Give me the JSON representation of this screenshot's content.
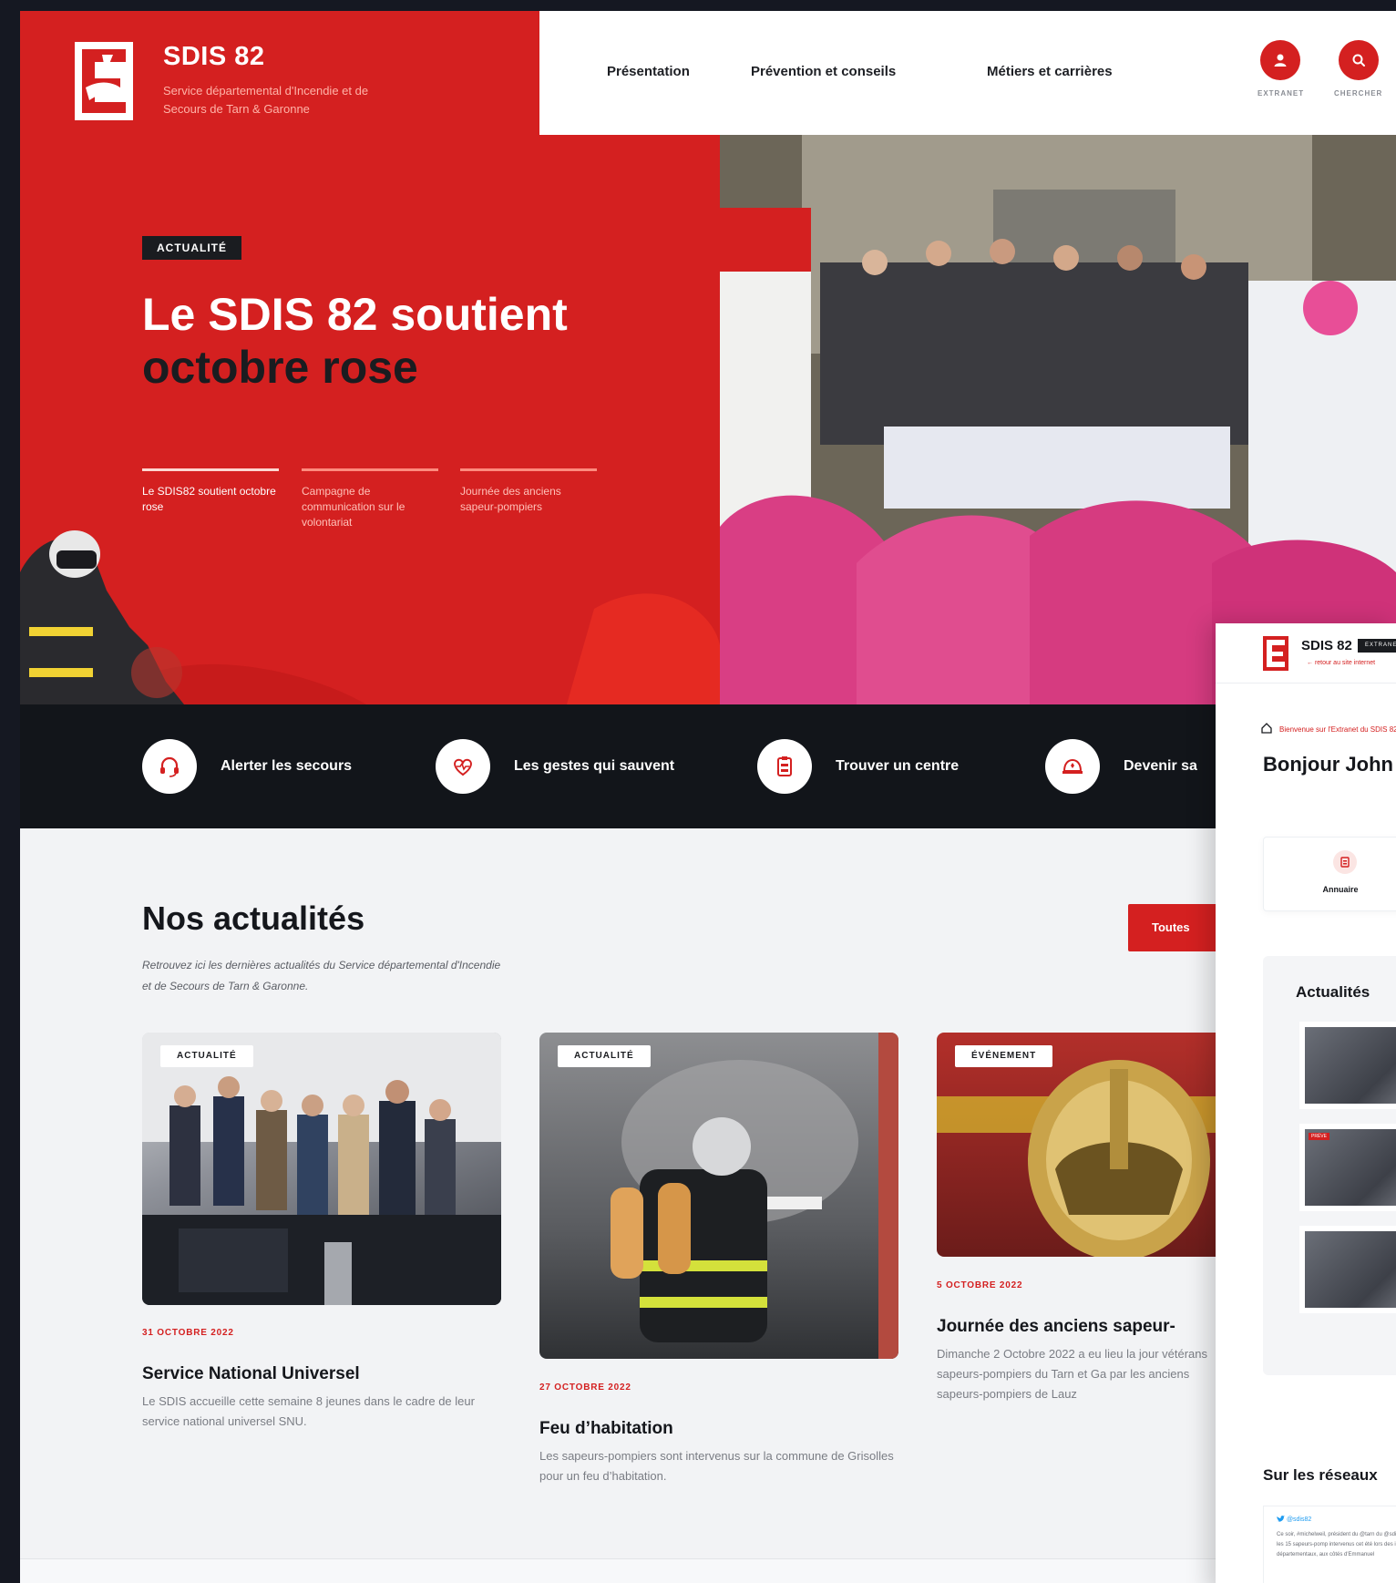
{
  "brand": {
    "title": "SDIS 82",
    "subtitle": "Service départemental d'Incendie et de Secours de Tarn & Garonne"
  },
  "nav": {
    "items": [
      {
        "label": "Présentation"
      },
      {
        "label": "Prévention et conseils"
      },
      {
        "label": "Métiers et carrières"
      }
    ],
    "extranet_label": "EXTRANET",
    "search_label": "CHERCHER",
    "accent_color": "#d42020"
  },
  "hero": {
    "badge": "ACTUALITÉ",
    "title_line1": "Le SDIS 82 soutient",
    "title_line2": "octobre rose",
    "slides": [
      {
        "label": "Le SDIS82 soutient octobre rose",
        "active": true
      },
      {
        "label": "Campagne de communication sur le volontariat",
        "active": false
      },
      {
        "label": "Journée des anciens sapeur-pompiers",
        "active": false
      }
    ]
  },
  "quick_links": [
    {
      "label": "Alerter les secours",
      "icon": "headset-icon"
    },
    {
      "label": "Les gestes qui sauvent",
      "icon": "heart-pulse-icon"
    },
    {
      "label": "Trouver un centre",
      "icon": "clipboard-icon"
    },
    {
      "label": "Devenir sa",
      "icon": "firefighter-helmet-icon"
    }
  ],
  "news": {
    "title": "Nos actualités",
    "intro": "Retrouvez ici les dernières actualités du Service départemental d'Incendie et de Secours de Tarn & Garonne.",
    "all_button": "Toutes",
    "cards": [
      {
        "badge": "ACTUALITÉ",
        "date": "31 OCTOBRE 2022",
        "title": "Service National Universel",
        "text": "Le SDIS accueille cette semaine 8 jeunes dans le cadre de leur service national universel SNU."
      },
      {
        "badge": "ACTUALITÉ",
        "date": "27 OCTOBRE 2022",
        "title": "Feu d’habitation",
        "text": "Les sapeurs-pompiers sont intervenus sur la commune de Grisolles pour un feu d’habitation."
      },
      {
        "badge": "ÉVÉNEMENT",
        "date": "5 OCTOBRE 2022",
        "title": "Journée des anciens sapeur-",
        "text": "Dimanche 2 Octobre 2022 a eu lieu la jour vétérans sapeurs-pompiers du Tarn et Ga par les anciens sapeurs-pompiers de Lauz"
      }
    ]
  },
  "extranet": {
    "brand": "SDIS 82",
    "badge": "EXTRANET",
    "back_link": "retour au site internet",
    "welcome": "Bienvenue sur l'Extranet du SDIS 82",
    "greeting": "Bonjour John",
    "shortcut": "Annuaire",
    "news_title": "Actualités",
    "news_tag": "PRÉVE",
    "social_title": "Sur les réseaux",
    "tweet_handle": "@sdis82",
    "tweet_text": "Ce soir, #michelweil, président du @tarn du @sdis82 remercie les 15 sapeurs-pomp intervenus cet été lors des incendies, en r départementaux, aux côtés d'Emmanuel"
  }
}
